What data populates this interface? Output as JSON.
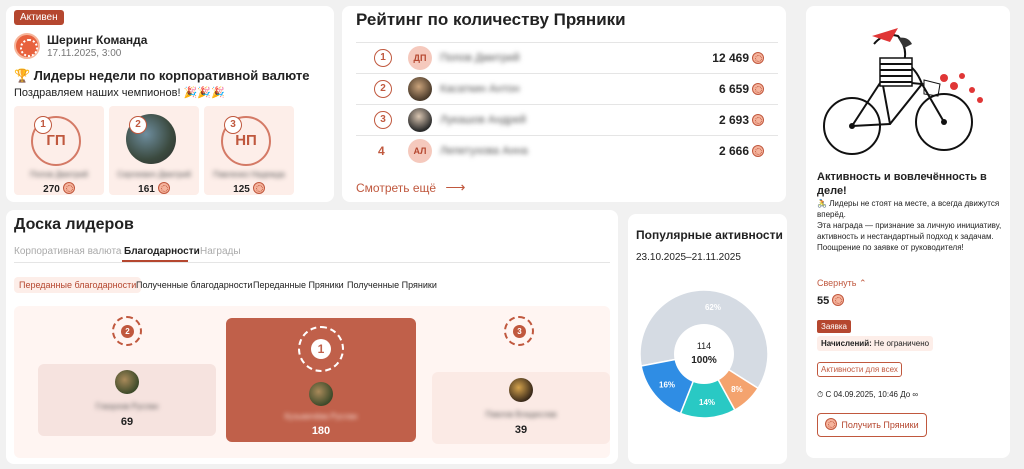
{
  "post": {
    "status": "Активен",
    "author": "Шеринг Команда",
    "date": "17.11.2025, 3:00",
    "title": "🏆 Лидеры недели по корпоративной валюте",
    "subtitle": "Поздравляем наших чемпионов! 🎉🎉🎉",
    "winners": [
      {
        "pos": "1",
        "initials": "ГП",
        "name": "Попов Дмитрий",
        "value": "270"
      },
      {
        "pos": "2",
        "initials": "",
        "name": "Сергеевич Дмитрий",
        "value": "161"
      },
      {
        "pos": "3",
        "initials": "НП",
        "name": "Павленко Надежда",
        "value": "125"
      }
    ]
  },
  "rating": {
    "title": "Рейтинг по количеству Пряники",
    "rows": [
      {
        "pos": "1",
        "initials": "ДП",
        "name": "Попов Дмитрий",
        "value": "12 469"
      },
      {
        "pos": "2",
        "initials": "",
        "name": "Касаткин Антон",
        "value": "6 659"
      },
      {
        "pos": "3",
        "initials": "",
        "name": "Лукашов Андрей",
        "value": "2 693"
      },
      {
        "pos": "4",
        "initials": "АЛ",
        "name": "Лепетухова Анна",
        "value": "2 666"
      }
    ],
    "more_label": "Смотреть ещё",
    "more_arrow": "⟶"
  },
  "board": {
    "title": "Доска лидеров",
    "tabs": [
      "Корпоративная валюта",
      "Благодарности",
      "Награды"
    ],
    "active_tab": "Благодарности",
    "subtabs": [
      "Переданные благодарности",
      "Полученные благодарности",
      "Переданные Пряники",
      "Полученные Пряники"
    ],
    "podium": [
      {
        "pos": "2",
        "name": "Глазунов Руслан",
        "value": "69"
      },
      {
        "pos": "1",
        "name": "Кузьмичёва Руслан",
        "value": "180"
      },
      {
        "pos": "3",
        "name": "Павлов Владислав",
        "value": "39"
      }
    ]
  },
  "popular": {
    "title": "Популярные активности",
    "range": "23.10.2025–21.11.2025",
    "total": "114",
    "total_pct": "100%"
  },
  "chart_data": {
    "type": "pie",
    "slices": [
      {
        "label": "62%",
        "value": 62,
        "color": "#d5dbe3"
      },
      {
        "label": "8%",
        "value": 8,
        "color": "#f4a36e"
      },
      {
        "label": "14%",
        "value": 14,
        "color": "#29c9c4"
      },
      {
        "label": "16%",
        "value": 16,
        "color": "#2f8de4"
      }
    ],
    "center_total": "114",
    "center_pct": "100%"
  },
  "activity": {
    "title": "Активность и вовлечённость в деле!",
    "desc_1": "🚴 Лидеры не стоят на месте, а всегда движутся вперёд.",
    "desc_2": "Эта награда — признание за личную инициативу, активность и нестандартный подход к задачам.",
    "desc_3": "Поощрение по заявке от руководителя!",
    "collapse_label": "Свернуть ⌃",
    "price": "55",
    "tag_application": "Заявка",
    "limit_label": "Начислений:",
    "limit_value": "Не ограничено",
    "tag_all": "Активности для всех",
    "period": "⏱ С 04.09.2025, 10:46 До ∞",
    "button": "Получить Пряники"
  }
}
